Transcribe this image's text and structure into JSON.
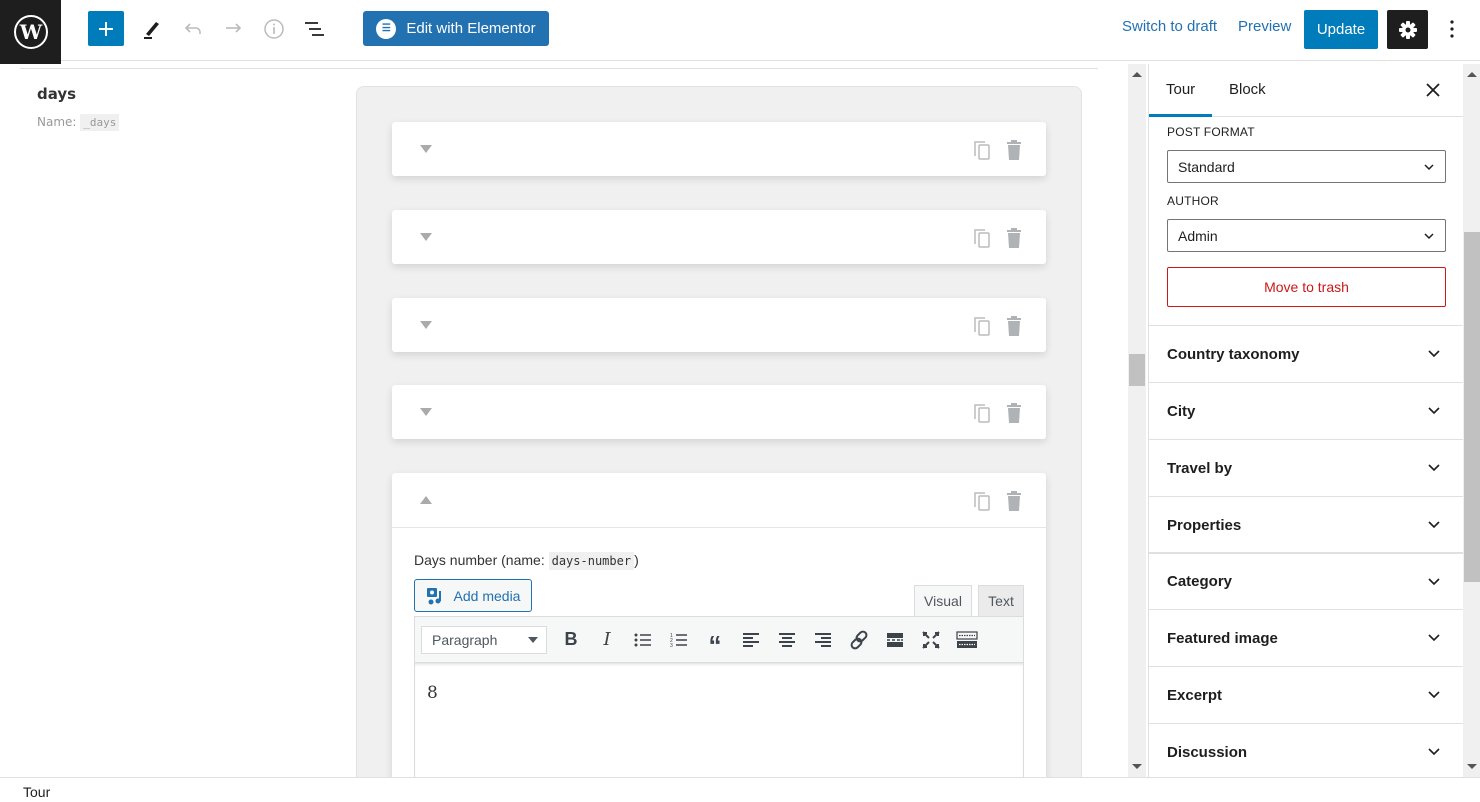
{
  "topbar": {
    "elementor_label": "Edit with Elementor",
    "switch_to_draft": "Switch to draft",
    "preview": "Preview",
    "update": "Update",
    "icons": [
      "wordpress-logo",
      "plus-icon",
      "pencil-icon",
      "undo-icon",
      "redo-icon",
      "info-icon",
      "list-view-icon",
      "elementor-icon",
      "gear-icon",
      "more-vertical-icon"
    ]
  },
  "editor": {
    "field": {
      "label": "days",
      "name_prefix": "Name:",
      "name_value": "_days"
    },
    "repeater_items": [
      {
        "expanded": false
      },
      {
        "expanded": false
      },
      {
        "expanded": false
      },
      {
        "expanded": false
      },
      {
        "expanded": true
      }
    ],
    "subfield": {
      "label_prefix": "Days number (name:",
      "name_code": "days-number",
      "label_suffix": ")",
      "add_media": "Add media",
      "tab_visual": "Visual",
      "tab_text": "Text",
      "format_select": "Paragraph",
      "toolbar_tools": [
        "bold",
        "italic",
        "bulleted-list",
        "numbered-list",
        "blockquote",
        "align-left",
        "align-center",
        "align-right",
        "link",
        "read-more",
        "fullscreen",
        "toolbar-toggle"
      ],
      "content": "8"
    }
  },
  "sidebar": {
    "tabs": [
      {
        "label": "Tour",
        "active": true
      },
      {
        "label": "Block",
        "active": false
      }
    ],
    "post_format_label": "POST FORMAT",
    "post_format_value": "Standard",
    "author_label": "AUTHOR",
    "author_value": "Admin",
    "move_to_trash": "Move to trash",
    "panels": [
      "Country taxonomy",
      "City",
      "Travel by",
      "Properties",
      "Category",
      "Featured image",
      "Excerpt",
      "Discussion"
    ]
  },
  "footer": {
    "breadcrumb": "Tour"
  },
  "colors": {
    "accent": "#007cba",
    "elementor": "#2271b1",
    "danger": "#cc1818",
    "dark": "#1e1e1e"
  }
}
